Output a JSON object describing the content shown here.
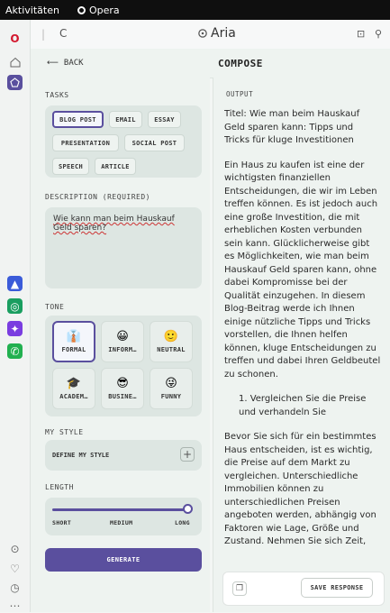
{
  "os_bar": {
    "activities": "Aktivitäten",
    "app_name": "Opera"
  },
  "browser": {
    "title": "Aria"
  },
  "header": {
    "back": "BACK",
    "title": "COMPOSE"
  },
  "tasks": {
    "label": "TASKS",
    "items": [
      "BLOG POST",
      "EMAIL",
      "ESSAY",
      "PRESENTATION",
      "SOCIAL POST",
      "SPEECH",
      "ARTICLE"
    ],
    "selected": "BLOG POST"
  },
  "description": {
    "label": "DESCRIPTION (REQUIRED)",
    "value": "Wie kann man beim Hauskauf Geld sparen?"
  },
  "tone": {
    "label": "TONE",
    "items": [
      {
        "label": "FORMAL",
        "emoji": "👔"
      },
      {
        "label": "INFORM…",
        "emoji": "😀"
      },
      {
        "label": "NEUTRAL",
        "emoji": "🙂"
      },
      {
        "label": "ACADEM…",
        "emoji": "🎓"
      },
      {
        "label": "BUSINE…",
        "emoji": "😎"
      },
      {
        "label": "FUNNY",
        "emoji": "😜"
      }
    ],
    "selected": "FORMAL"
  },
  "my_style": {
    "label": "MY STYLE",
    "define": "DEFINE MY STYLE",
    "plus": "+"
  },
  "length": {
    "label": "LENGTH",
    "short": "SHORT",
    "medium": "MEDIUM",
    "long": "LONG",
    "value_fraction": 1.0
  },
  "generate": "GENERATE",
  "output": {
    "label": "OUTPUT",
    "paragraphs": [
      "Titel: Wie man beim Hauskauf Geld sparen kann: Tipps und Tricks für kluge Investitionen",
      "Ein Haus zu kaufen ist eine der wichtigsten finanziellen Entscheidungen, die wir im Leben treffen können. Es ist jedoch auch eine große Investition, die mit erheblichen Kosten verbunden sein kann. Glücklicherweise gibt es Möglichkeiten, wie man beim Hauskauf Geld sparen kann, ohne dabei Kompromisse bei der Qualität einzugehen. In diesem Blog-Beitrag werde ich Ihnen einige nützliche Tipps und Tricks vorstellen, die Ihnen helfen können, kluge Entscheidungen zu treffen und dabei Ihren Geldbeutel zu schonen.",
      "1. Vergleichen Sie die Preise und verhandeln Sie",
      "Bevor Sie sich für ein bestimmtes Haus entscheiden, ist es wichtig, die Preise auf dem Markt zu vergleichen. Unterschiedliche Immobilien können zu unterschiedlichen Preisen angeboten werden, abhängig von Faktoren wie Lage, Größe und Zustand. Nehmen Sie sich Zeit, um verschiedene Angebote zu prüfen und verhandeln Sie, um den bestmöglichen Preis zu erzielen. Oft können Sie durch geschicktes Verhandeln einige tausend Euro"
    ],
    "save": "SAVE RESPONSE"
  },
  "colors": {
    "accent": "#5a4f9e",
    "panel": "#eef3f0",
    "card": "#dde6e2",
    "opera_red": "#d3172d"
  }
}
